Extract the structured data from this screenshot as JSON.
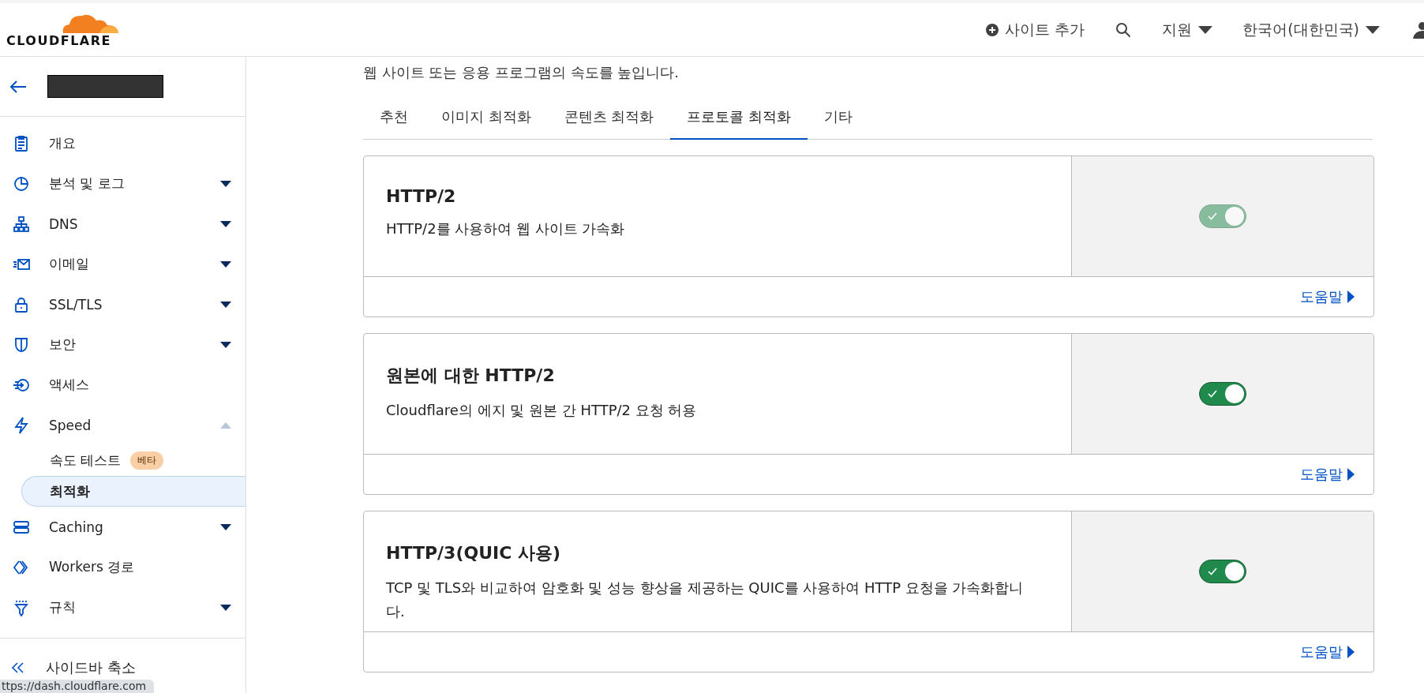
{
  "header": {
    "logo": "CLOUDFLARE",
    "add_site": "사이트 추가",
    "support": "지원",
    "language": "한국어(대한민국)"
  },
  "sidebar": {
    "items": [
      {
        "label": "개요"
      },
      {
        "label": "분석 및 로그",
        "expanded": false
      },
      {
        "label": "DNS",
        "expanded": false
      },
      {
        "label": "이메일",
        "expanded": false
      },
      {
        "label": "SSL/TLS",
        "expanded": false
      },
      {
        "label": "보안",
        "expanded": false
      },
      {
        "label": "액세스"
      },
      {
        "label": "Speed",
        "expanded": true,
        "children": [
          {
            "label": "속도 테스트",
            "badge": "베타",
            "selected": false
          },
          {
            "label": "최적화",
            "selected": true
          }
        ]
      },
      {
        "label": "Caching",
        "expanded": false
      },
      {
        "label": "Workers 경로"
      },
      {
        "label": "규칙",
        "expanded": false
      }
    ],
    "collapse": "사이드바 축소"
  },
  "status_bar": {
    "url": "ttps://dash.cloudflare.com"
  },
  "subtitle": "웹 사이트 또는 응용 프로그램의 속도를 높입니다.",
  "tabs": [
    {
      "label": "추천",
      "selected": false
    },
    {
      "label": "이미지 최적화",
      "selected": false
    },
    {
      "label": "콘텐츠 최적화",
      "selected": false
    },
    {
      "label": "프로토콜 최적화",
      "selected": true
    },
    {
      "label": "기타",
      "selected": false
    }
  ],
  "cards": [
    {
      "title": "HTTP/2",
      "description": "HTTP/2를 사용하여 웹 사이트 가속화",
      "on": true,
      "disabled": true,
      "help": "도움말"
    },
    {
      "title": "원본에 대한 HTTP/2",
      "description": "Cloudflare의 에지 및 원본 간 HTTP/2 요청 허용",
      "on": true,
      "disabled": false,
      "help": "도움말"
    },
    {
      "title": "HTTP/3(QUIC 사용)",
      "description": "TCP 및 TLS와 비교하여 암호화 및 성능 향상을 제공하는 QUIC를 사용하여 HTTP 요청을 가속화합니다.",
      "on": true,
      "disabled": false,
      "help": "도움말"
    }
  ]
}
